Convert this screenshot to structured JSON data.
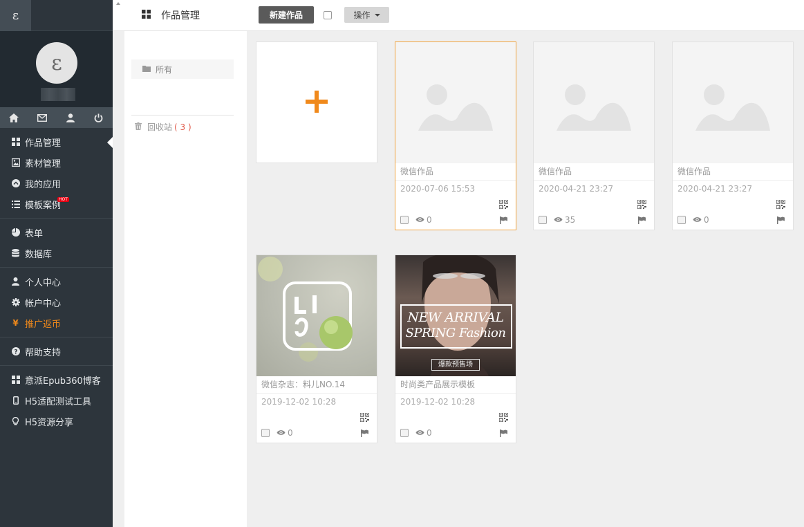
{
  "app": {
    "logo_glyph": "ε",
    "avatar_glyph": "ε"
  },
  "sidebar": {
    "quick_icons": [
      "home-icon",
      "mail-icon",
      "user-icon",
      "power-icon"
    ],
    "groups": [
      [
        {
          "label": "作品管理",
          "icon": "grid-icon",
          "active": true
        },
        {
          "label": "素材管理",
          "icon": "image-icon"
        },
        {
          "label": "我的应用",
          "icon": "chevron-circle-icon"
        },
        {
          "label": "模板案例",
          "icon": "list-icon",
          "badge": "HOT"
        }
      ],
      [
        {
          "label": "表单",
          "icon": "pie-chart-icon"
        },
        {
          "label": "数据库",
          "icon": "database-icon"
        }
      ],
      [
        {
          "label": "个人中心",
          "icon": "user-icon"
        },
        {
          "label": "帐户中心",
          "icon": "gear-icon"
        },
        {
          "label": "推广返币",
          "icon": "yen-icon",
          "highlight": true
        }
      ],
      [
        {
          "label": "帮助支持",
          "icon": "question-icon"
        }
      ],
      [
        {
          "label": "意派Epub360博客",
          "icon": "grid-icon"
        },
        {
          "label": "H5适配测试工具",
          "icon": "mobile-icon"
        },
        {
          "label": "H5资源分享",
          "icon": "lightbulb-icon"
        }
      ]
    ]
  },
  "header": {
    "title": "作品管理",
    "new_button": "新建作品",
    "op_button": "操作"
  },
  "folders": {
    "all_label": "所有",
    "trash_label": "回收站",
    "trash_count": "( 3 )"
  },
  "colors": {
    "accent": "#f0891b",
    "sidebar_bg": "#2d353c",
    "selected_border": "#f0a13a"
  },
  "works": [
    {
      "name": "微信作品",
      "date": "2020-07-06 15:53",
      "views": "0",
      "thumb": "placeholder",
      "selected": true
    },
    {
      "name": "微信作品",
      "date": "2020-04-21 23:27",
      "views": "35",
      "thumb": "placeholder"
    },
    {
      "name": "微信作品",
      "date": "2020-04-21 23:27",
      "views": "0",
      "thumb": "placeholder"
    },
    {
      "name": "微信杂志：料儿NO.14",
      "date": "2019-12-02 10:28",
      "views": "0",
      "thumb": "liao"
    },
    {
      "name": "时尚类产品展示模板",
      "date": "2019-12-02 10:28",
      "views": "0",
      "thumb": "fashion",
      "thumb_text": {
        "line1": "NEW ARRIVAL",
        "line2": "SPRING Fashion",
        "tag": "爆款预售场"
      }
    }
  ]
}
